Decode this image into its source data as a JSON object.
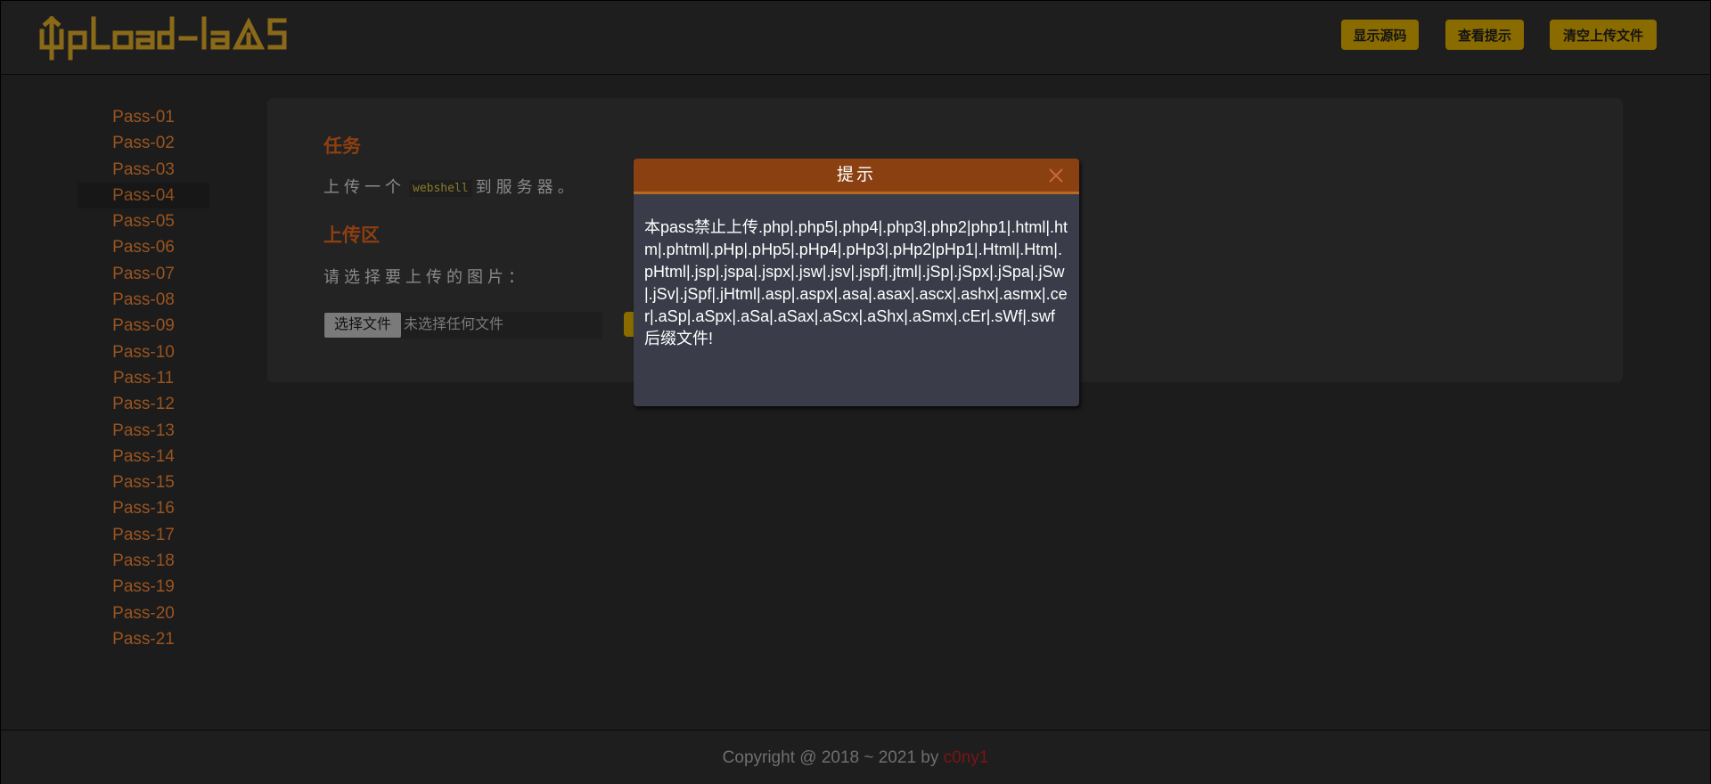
{
  "header": {
    "logo_text": "UpLoad-labs",
    "buttons": {
      "show_source": "显示源码",
      "view_hint": "查看提示",
      "clear_uploads": "清空上传文件"
    }
  },
  "sidebar": {
    "active": "Pass-04",
    "items": [
      {
        "label": "Pass-01"
      },
      {
        "label": "Pass-02"
      },
      {
        "label": "Pass-03"
      },
      {
        "label": "Pass-04"
      },
      {
        "label": "Pass-05"
      },
      {
        "label": "Pass-06"
      },
      {
        "label": "Pass-07"
      },
      {
        "label": "Pass-08"
      },
      {
        "label": "Pass-09"
      },
      {
        "label": "Pass-10"
      },
      {
        "label": "Pass-11"
      },
      {
        "label": "Pass-12"
      },
      {
        "label": "Pass-13"
      },
      {
        "label": "Pass-14"
      },
      {
        "label": "Pass-15"
      },
      {
        "label": "Pass-16"
      },
      {
        "label": "Pass-17"
      },
      {
        "label": "Pass-18"
      },
      {
        "label": "Pass-19"
      },
      {
        "label": "Pass-20"
      },
      {
        "label": "Pass-21"
      }
    ]
  },
  "main": {
    "task_title": "任务",
    "task_text_before": "上传一个",
    "task_code": "webshell",
    "task_text_after": "到服务器。",
    "upload_title": "上传区",
    "upload_prompt": "请选择要上传的图片：",
    "file_button": "选择文件",
    "file_status": "未选择任何文件"
  },
  "modal": {
    "title": "提示",
    "message": "本pass禁止上传.php|.php5|.php4|.php3|.php2|php1|.html|.htm|.phtml|.pHp|.pHp5|.pHp4|.pHp3|.pHp2|pHp1|.Html|.Htm|.pHtml|.jsp|.jspa|.jspx|.jsw|.jsv|.jspf|.jtml|.jSp|.jSpx|.jSpa|.jSw|.jSv|.jSpf|.jHtml|.asp|.aspx|.asa|.asax|.ascx|.ashx|.asmx|.cer|.aSp|.aSpx|.aSa|.aSax|.aScx|.aShx|.aSmx|.cEr|.sWf|.swf后缀文件!"
  },
  "footer": {
    "copyright": "Copyright @ 2018 ~ 2021 by ",
    "author": "c0ny1"
  },
  "colors": {
    "accent_button": "#8a6b00",
    "sidebar_link": "#9a5420",
    "modal_header": "#8b4011",
    "modal_body": "#3a3d49"
  }
}
